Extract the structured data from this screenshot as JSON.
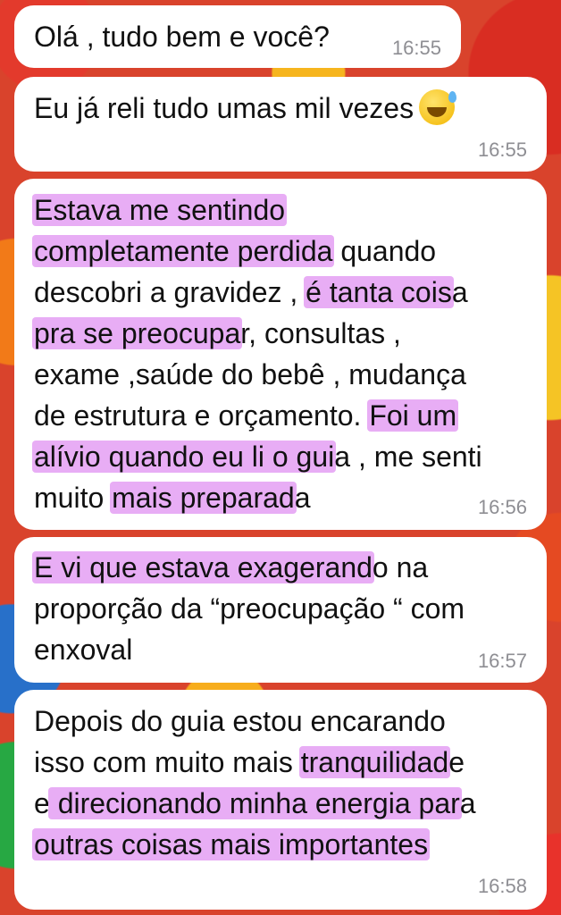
{
  "messages": [
    {
      "lines": [
        [
          {
            "t": "Olá , tudo bem e você?",
            "h": false
          }
        ]
      ],
      "time": "16:55"
    },
    {
      "lines": [
        [
          {
            "t": "Eu já reli tudo umas mil vezes",
            "h": false
          }
        ]
      ],
      "emoji": "sweat-smile-emoji",
      "time": "16:55"
    },
    {
      "lines": [
        [
          {
            "t": "Estava me sentindo",
            "h": true
          }
        ],
        [
          {
            "t": "completamente perdida",
            "h": true
          },
          {
            "t": " quando",
            "h": false
          }
        ],
        [
          {
            "t": "descobri a gravidez , ",
            "h": false
          },
          {
            "t": "é tanta cois",
            "h": true
          },
          {
            "t": "a",
            "h": false
          }
        ],
        [
          {
            "t": "pra se preocupa",
            "h": true
          },
          {
            "t": "r, consultas ,",
            "h": false
          }
        ],
        [
          {
            "t": "exame ,saúde do bebê , mudança",
            "h": false
          }
        ],
        [
          {
            "t": "de estrutura e orçamento. ",
            "h": false
          },
          {
            "t": "Foi um",
            "h": true
          }
        ],
        [
          {
            "t": "alívio quando eu li o gui",
            "h": true
          },
          {
            "t": "a , me senti",
            "h": false
          }
        ],
        [
          {
            "t": "muito ",
            "h": false
          },
          {
            "t": "mais preparad",
            "h": true
          },
          {
            "t": "a",
            "h": false
          }
        ]
      ],
      "time": "16:56"
    },
    {
      "lines": [
        [
          {
            "t": "E vi que estava exagerand",
            "h": true
          },
          {
            "t": "o na",
            "h": false
          }
        ],
        [
          {
            "t": "proporção da “preocupação “ com",
            "h": false
          }
        ],
        [
          {
            "t": "enxoval",
            "h": false
          }
        ]
      ],
      "time": "16:57"
    },
    {
      "lines": [
        [
          {
            "t": "Depois do guia estou encarando",
            "h": false
          }
        ],
        [
          {
            "t": "isso com muito mais ",
            "h": false
          },
          {
            "t": "tranquilidad",
            "h": true
          },
          {
            "t": "e",
            "h": false
          }
        ],
        [
          {
            "t": "e",
            "h": false
          },
          {
            "t": " direcionando minha energia par",
            "h": true
          },
          {
            "t": "a",
            "h": false
          }
        ],
        [
          {
            "t": "outras coisas mais importantes",
            "h": true
          }
        ]
      ],
      "time": "16:58"
    }
  ],
  "colors": {
    "bubble": "#ffffff",
    "highlight": "#e8adf5",
    "timestamp": "#8e8e93"
  }
}
